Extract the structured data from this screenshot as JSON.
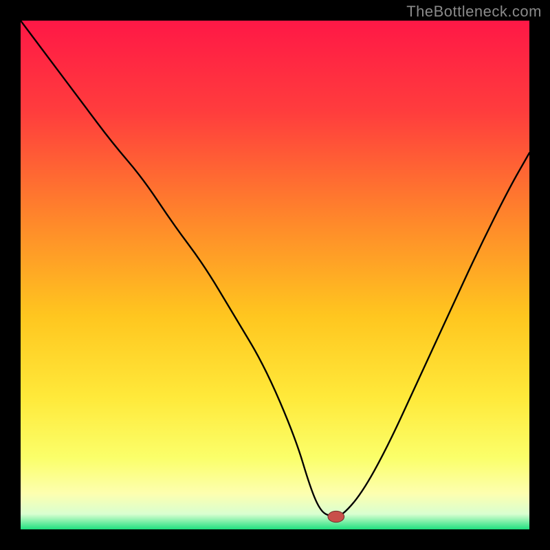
{
  "watermark": "TheBottleneck.com",
  "colors": {
    "frame": "#000000",
    "watermark": "#8a8a8a",
    "gradient_stops": [
      {
        "offset": 0.0,
        "color": "#ff1846"
      },
      {
        "offset": 0.18,
        "color": "#ff3d3d"
      },
      {
        "offset": 0.4,
        "color": "#ff8a2a"
      },
      {
        "offset": 0.58,
        "color": "#ffc61f"
      },
      {
        "offset": 0.74,
        "color": "#ffe93a"
      },
      {
        "offset": 0.86,
        "color": "#fbff6a"
      },
      {
        "offset": 0.93,
        "color": "#fdffb0"
      },
      {
        "offset": 0.97,
        "color": "#d9ffd0"
      },
      {
        "offset": 1.0,
        "color": "#1fe07f"
      }
    ],
    "curve": "#000000",
    "marker_fill": "#c94f4a",
    "marker_stroke": "#6e2e2a"
  },
  "chart_data": {
    "type": "line",
    "title": "",
    "xlabel": "",
    "ylabel": "",
    "xlim": [
      0,
      100
    ],
    "ylim": [
      0,
      100
    ],
    "grid": false,
    "legend": false,
    "series": [
      {
        "name": "bottleneck-curve",
        "x": [
          0,
          6,
          12,
          18,
          24,
          30,
          36,
          42,
          48,
          54,
          57,
          59,
          61,
          63,
          67,
          72,
          78,
          84,
          90,
          96,
          100
        ],
        "y": [
          100,
          92,
          84,
          76,
          69,
          60,
          52,
          42,
          32,
          18,
          8,
          3.5,
          2.5,
          2.5,
          7,
          16,
          29,
          42,
          55,
          67,
          74
        ]
      }
    ],
    "marker": {
      "x": 62,
      "y": 2.5,
      "rx": 1.6,
      "ry": 1.1
    },
    "flat_minimum": {
      "x_start": 59,
      "x_end": 63,
      "y": 2.5
    }
  }
}
